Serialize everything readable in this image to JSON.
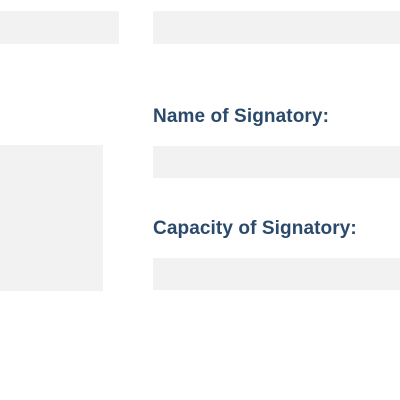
{
  "form": {
    "top_left_field": {
      "value": ""
    },
    "top_right_field": {
      "value": ""
    },
    "signature_box": {
      "value": ""
    },
    "name_of_signatory": {
      "label": "Name of Signatory:",
      "value": ""
    },
    "capacity_of_signatory": {
      "label": "Capacity of Signatory:",
      "value": ""
    }
  },
  "colors": {
    "label_text": "#2b4a6b",
    "field_background": "#f2f2f2",
    "page_background": "#ffffff"
  }
}
